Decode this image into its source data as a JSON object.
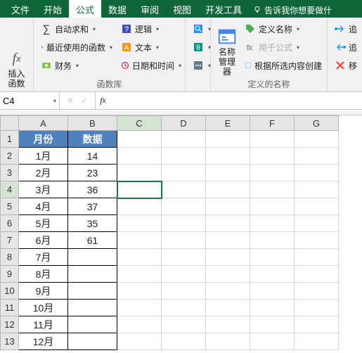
{
  "tabs": {
    "file": "文件",
    "home": "开始",
    "formulas": "公式",
    "data": "数据",
    "review": "审阅",
    "view": "视图",
    "developer": "开发工具",
    "tell_me": "告诉我你想要做什"
  },
  "ribbon": {
    "group1_label": "",
    "insert_fn": "插入函数",
    "autosum": "自动求和",
    "recent": "最近使用的函数",
    "financial": "财务",
    "logical": "逻辑",
    "text": "文本",
    "datetime": "日期和时间",
    "group2_label": "函数库",
    "name_mgr": "名称\n管理器",
    "define_name": "定义名称",
    "use_in_formula": "用于公式",
    "create_from_sel": "根据所选内容创建",
    "group3_label": "定义的名称",
    "trace1": "追",
    "trace2": "追",
    "remove": "移"
  },
  "nameBox": "C4",
  "formula": "",
  "columns": [
    "A",
    "B",
    "C",
    "D",
    "E",
    "F",
    "G"
  ],
  "rowCount": 13,
  "headerA": "月份",
  "headerB": "数据",
  "chart_data": {
    "type": "table",
    "columns": [
      "月份",
      "数据"
    ],
    "rows": [
      {
        "月份": "1月",
        "数据": 14
      },
      {
        "月份": "2月",
        "数据": 23
      },
      {
        "月份": "3月",
        "数据": 36
      },
      {
        "月份": "4月",
        "数据": 37
      },
      {
        "月份": "5月",
        "数据": 35
      },
      {
        "月份": "6月",
        "数据": 61
      },
      {
        "月份": "7月",
        "数据": null
      },
      {
        "月份": "8月",
        "数据": null
      },
      {
        "月份": "9月",
        "数据": null
      },
      {
        "月份": "10月",
        "数据": null
      },
      {
        "月份": "11月",
        "数据": null
      },
      {
        "月份": "12月",
        "数据": null
      }
    ]
  },
  "selectedCell": {
    "row": 4,
    "col": "C"
  }
}
